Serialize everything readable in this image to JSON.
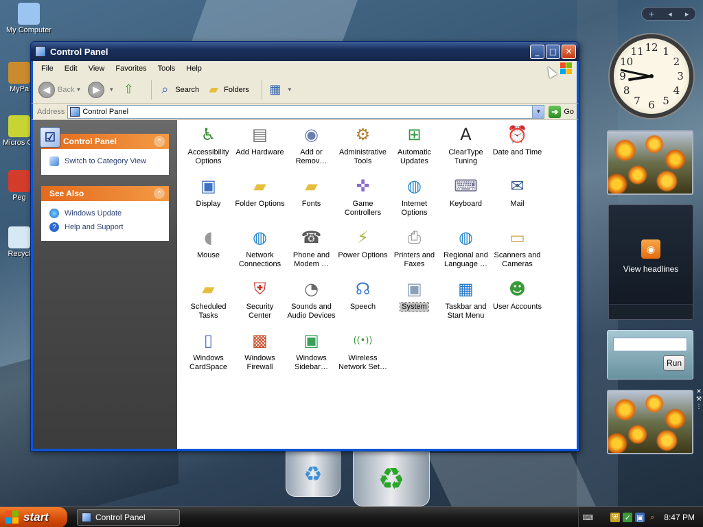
{
  "desktop": {
    "icons": [
      {
        "label": "My Computer",
        "icon": "computer-icon",
        "color": "#9cc4f0"
      },
      {
        "label": "MyPa",
        "icon": "folder-icon",
        "color": "#c98b2d"
      },
      {
        "label": "Micros Outlo",
        "icon": "outlook-icon",
        "color": "#c7d434"
      },
      {
        "label": "Peg",
        "icon": "game-icon",
        "color": "#d33b2b"
      },
      {
        "label": "Recycl",
        "icon": "recycle-bin-icon",
        "color": "#d5e8f4"
      }
    ]
  },
  "window": {
    "title": "Control Panel",
    "min_glyph": "_",
    "max_glyph": "□",
    "close_glyph": "✕"
  },
  "menu": [
    "File",
    "Edit",
    "View",
    "Favorites",
    "Tools",
    "Help"
  ],
  "toolbar": {
    "back": "Back",
    "search": "Search",
    "folders": "Folders"
  },
  "address": {
    "label": "Address",
    "value": "Control Panel",
    "go": "Go"
  },
  "taskpane": {
    "control_panel": {
      "title": "Control Panel",
      "links": [
        "Switch to Category View"
      ]
    },
    "see_also": {
      "title": "See Also",
      "links": [
        "Windows Update",
        "Help and Support"
      ]
    }
  },
  "items": [
    {
      "label": "Accessibility Options",
      "icon": "accessibility-icon",
      "glyph": "♿",
      "color": "#2c8a2c"
    },
    {
      "label": "Add Hardware",
      "icon": "add-hardware-icon",
      "glyph": "▤",
      "color": "#6b6b6b"
    },
    {
      "label": "Add or Remov…",
      "icon": "add-remove-programs-icon",
      "glyph": "◉",
      "color": "#6a7fb0"
    },
    {
      "label": "Administrative Tools",
      "icon": "administrative-tools-icon",
      "glyph": "⚙",
      "color": "#b37b2e"
    },
    {
      "label": "Automatic Updates",
      "icon": "automatic-updates-icon",
      "glyph": "⊞",
      "color": "#2e9a3e"
    },
    {
      "label": "ClearType Tuning",
      "icon": "cleartype-icon",
      "glyph": "A",
      "color": "#2a2a2a"
    },
    {
      "label": "Date and Time",
      "icon": "date-time-icon",
      "glyph": "⏰",
      "color": "#3a6ab0"
    },
    {
      "label": "Display",
      "icon": "display-icon",
      "glyph": "▣",
      "color": "#3f73c0"
    },
    {
      "label": "Folder Options",
      "icon": "folder-options-icon",
      "glyph": "▰",
      "color": "#e5be3d"
    },
    {
      "label": "Fonts",
      "icon": "fonts-icon",
      "glyph": "▰",
      "color": "#e5be3d"
    },
    {
      "label": "Game Controllers",
      "icon": "game-controllers-icon",
      "glyph": "✜",
      "color": "#8a6ad0"
    },
    {
      "label": "Internet Options",
      "icon": "internet-options-icon",
      "glyph": "◍",
      "color": "#2a88c8"
    },
    {
      "label": "Keyboard",
      "icon": "keyboard-icon",
      "glyph": "⌨",
      "color": "#6a6a8a"
    },
    {
      "label": "Mail",
      "icon": "mail-icon",
      "glyph": "✉",
      "color": "#3a5a8a"
    },
    {
      "label": "Mouse",
      "icon": "mouse-icon",
      "glyph": "◖",
      "color": "#9a9a9a"
    },
    {
      "label": "Network Connections",
      "icon": "network-connections-icon",
      "glyph": "◍",
      "color": "#2a88c8"
    },
    {
      "label": "Phone and Modem …",
      "icon": "phone-modem-icon",
      "glyph": "☎",
      "color": "#5a5a5a"
    },
    {
      "label": "Power Options",
      "icon": "power-options-icon",
      "glyph": "⚡",
      "color": "#b0b040"
    },
    {
      "label": "Printers and Faxes",
      "icon": "printers-faxes-icon",
      "glyph": "⎙",
      "color": "#8a8a8a"
    },
    {
      "label": "Regional and Language …",
      "icon": "regional-language-icon",
      "glyph": "◍",
      "color": "#2a88c8"
    },
    {
      "label": "Scanners and Cameras",
      "icon": "scanners-cameras-icon",
      "glyph": "▭",
      "color": "#c9a24a"
    },
    {
      "label": "Scheduled Tasks",
      "icon": "scheduled-tasks-icon",
      "glyph": "▰",
      "color": "#e5be3d"
    },
    {
      "label": "Security Center",
      "icon": "security-center-icon",
      "glyph": "⛨",
      "color": "#c8342a"
    },
    {
      "label": "Sounds and Audio Devices",
      "icon": "sounds-audio-icon",
      "glyph": "◔",
      "color": "#6a6a6a"
    },
    {
      "label": "Speech",
      "icon": "speech-icon",
      "glyph": "☊",
      "color": "#3a7ac8"
    },
    {
      "label": "System",
      "icon": "system-icon",
      "glyph": "▣",
      "color": "#8aa0b8",
      "selected": true
    },
    {
      "label": "Taskbar and Start Menu",
      "icon": "taskbar-start-menu-icon",
      "glyph": "▦",
      "color": "#2a7ac8"
    },
    {
      "label": "User Accounts",
      "icon": "user-accounts-icon",
      "glyph": "☻",
      "color": "#3a9a3a"
    },
    {
      "label": "Windows CardSpace",
      "icon": "cardspace-icon",
      "glyph": "▯",
      "color": "#5a7ac8"
    },
    {
      "label": "Windows Firewall",
      "icon": "windows-firewall-icon",
      "glyph": "▩",
      "color": "#c8502a"
    },
    {
      "label": "Windows Sidebar…",
      "icon": "windows-sidebar-icon",
      "glyph": "▣",
      "color": "#3aa05a"
    },
    {
      "label": "Wireless Network Set…",
      "icon": "wireless-network-icon",
      "glyph": "((•))",
      "color": "#3a9a3a"
    }
  ],
  "sidebar": {
    "ctrl_add": "+",
    "ctrl_prev": "◂",
    "ctrl_next": "▸",
    "clock_numbers": [
      "12",
      "1",
      "2",
      "3",
      "4",
      "5",
      "6",
      "7",
      "8",
      "9",
      "10",
      "11"
    ],
    "feed_label": "View headlines",
    "run_label": "Run"
  },
  "taskbar": {
    "start": "start",
    "task": "Control Panel",
    "time": "8:47 PM"
  },
  "colors": {
    "xp_orange": "#e46a1c",
    "window_blue": "#0a56d8",
    "link_blue": "#2c3f70"
  }
}
